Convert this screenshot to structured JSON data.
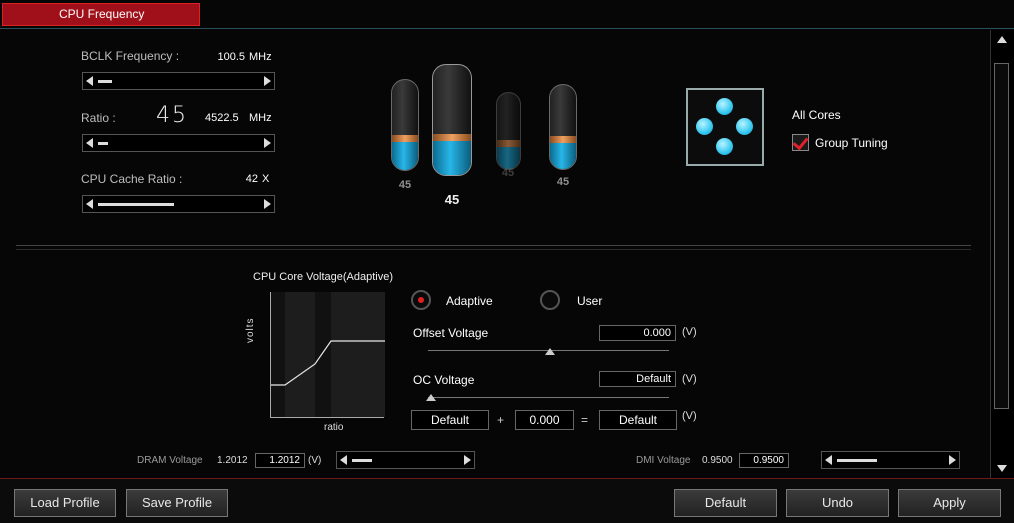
{
  "tab": {
    "label": "CPU Frequency"
  },
  "bclk": {
    "label": "BCLK Frequency :",
    "value": "100.5",
    "unit": "MHz"
  },
  "ratio": {
    "label": "Ratio :",
    "big": "45",
    "value": "4522.5",
    "unit": "MHz"
  },
  "cache": {
    "label": "CPU Cache Ratio :",
    "value": "42",
    "unit": "X"
  },
  "tubes": [
    {
      "label": "45"
    },
    {
      "label": "45"
    },
    {
      "label": "45"
    },
    {
      "label": "45"
    }
  ],
  "cores": {
    "title": "All Cores",
    "group_tuning": "Group Tuning",
    "group_tuning_checked": true
  },
  "voltage": {
    "title": "CPU Core Voltage(Adaptive)",
    "y_label": "volts",
    "x_label": "ratio",
    "mode_adaptive": "Adaptive",
    "mode_user": "User",
    "selected_mode": "Adaptive",
    "offset_label": "Offset Voltage",
    "offset_value": "0.000",
    "oc_label": "OC Voltage",
    "oc_value": "Default",
    "unit": "(V)",
    "sum_a": "Default",
    "plus": "+",
    "sum_b": "0.000",
    "equals": "=",
    "sum_result": "Default"
  },
  "dram": {
    "label": "DRAM Voltage",
    "current": "1.2012",
    "value": "1.2012",
    "unit": "(V)"
  },
  "dmi": {
    "label": "DMI Voltage",
    "current": "0.9500",
    "value": "0.9500"
  },
  "footer": {
    "load": "Load Profile",
    "save": "Save Profile",
    "default": "Default",
    "undo": "Undo",
    "apply": "Apply"
  },
  "colors": {
    "accent": "#a0101a",
    "liquid": "#28b6e8",
    "panel": "#060606"
  }
}
